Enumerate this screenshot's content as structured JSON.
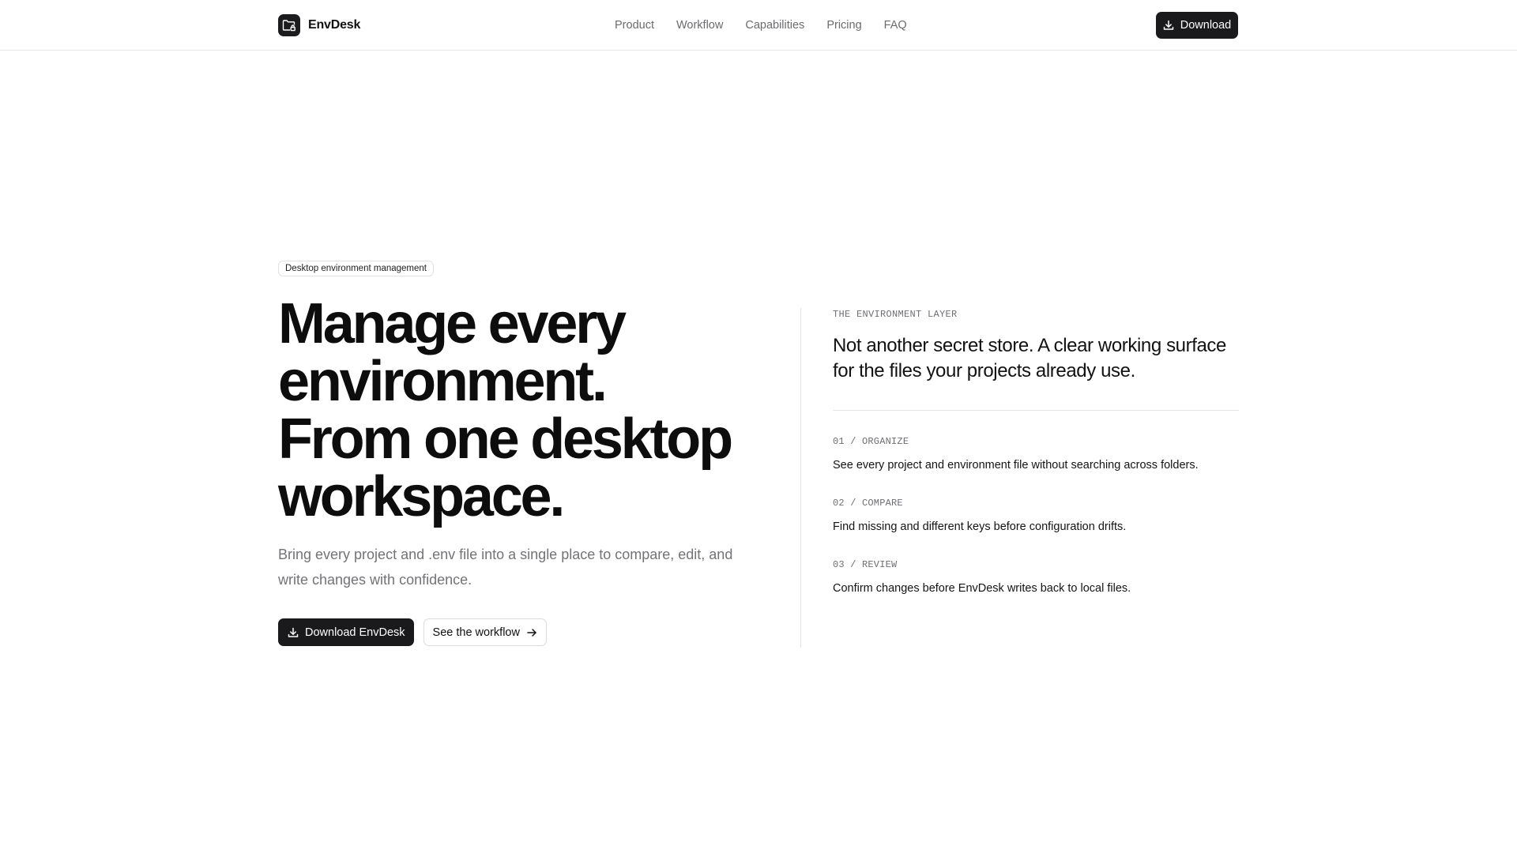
{
  "nav": {
    "brand": "EnvDesk",
    "links": [
      "Product",
      "Workflow",
      "Capabilities",
      "Pricing",
      "FAQ"
    ],
    "download_label": "Download"
  },
  "hero": {
    "badge": "Desktop environment management",
    "headline_lines": [
      "Manage every",
      "environment.",
      "From one desktop",
      "workspace."
    ],
    "subtitle": "Bring every project and .env file into a single place to compare, edit, and write changes with confidence.",
    "primary_cta": "Download EnvDesk",
    "secondary_cta": "See the workflow"
  },
  "panel": {
    "eyebrow": "THE ENVIRONMENT LAYER",
    "lede": "Not another secret store. A clear working surface for the files your projects already use.",
    "features": [
      {
        "label": "01 / ORGANIZE",
        "text": "See every project and environment file without searching across folders."
      },
      {
        "label": "02 / COMPARE",
        "text": "Find missing and different keys before configuration drifts."
      },
      {
        "label": "03 / REVIEW",
        "text": "Confirm changes before EnvDesk writes back to local files."
      }
    ]
  },
  "icons": {
    "logo": "folder-lock-icon",
    "download": "download-icon",
    "arrow": "arrow-right-icon"
  },
  "colors": {
    "primary": "#1a1a1c",
    "muted_text": "#6b6b70",
    "border": "#e4e4e4",
    "background": "#ffffff"
  }
}
